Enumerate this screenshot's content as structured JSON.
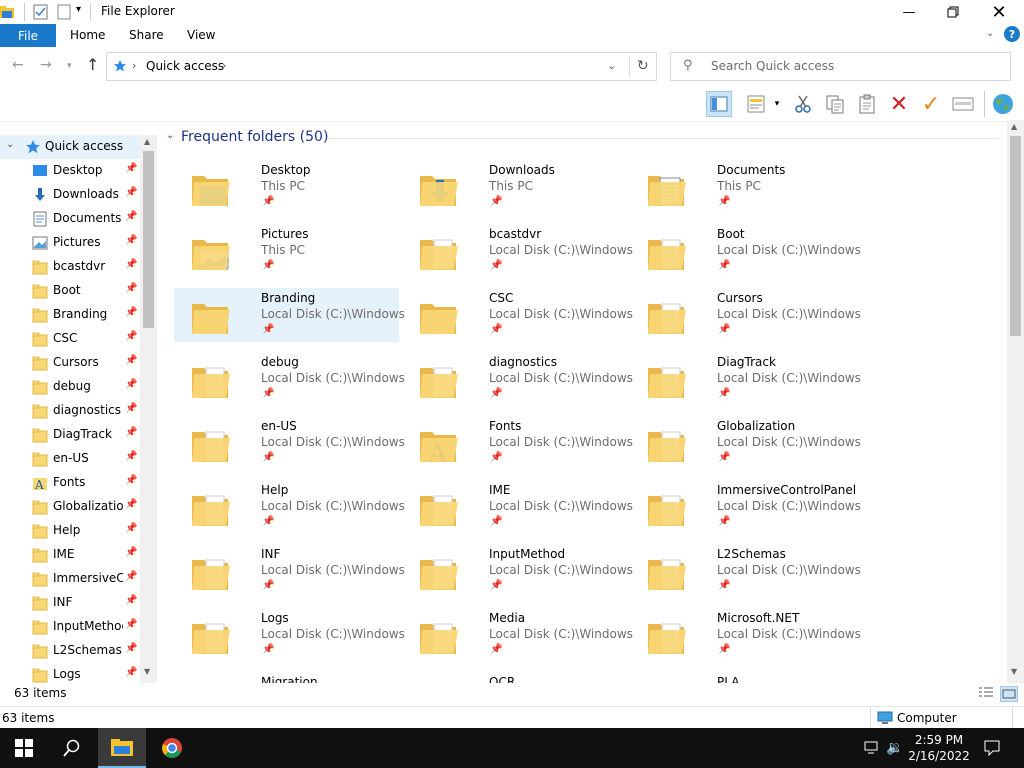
{
  "window": {
    "title": "File Explorer"
  },
  "ribbon": {
    "tabs": [
      {
        "label": "File"
      },
      {
        "label": "Home"
      },
      {
        "label": "Share"
      },
      {
        "label": "View"
      }
    ]
  },
  "address": {
    "path": "Quick access",
    "search_placeholder": "Search Quick access"
  },
  "nav": {
    "root_label": "Quick access",
    "items": [
      {
        "label": "Desktop",
        "icon": "desktop-icon"
      },
      {
        "label": "Downloads",
        "icon": "download-icon"
      },
      {
        "label": "Documents",
        "icon": "document-icon"
      },
      {
        "label": "Pictures",
        "icon": "picture-icon"
      },
      {
        "label": "bcastdvr",
        "icon": "folder-icon"
      },
      {
        "label": "Boot",
        "icon": "folder-icon"
      },
      {
        "label": "Branding",
        "icon": "folder-icon"
      },
      {
        "label": "CSC",
        "icon": "folder-icon"
      },
      {
        "label": "Cursors",
        "icon": "folder-icon"
      },
      {
        "label": "debug",
        "icon": "folder-icon"
      },
      {
        "label": "diagnostics",
        "icon": "folder-icon"
      },
      {
        "label": "DiagTrack",
        "icon": "folder-icon"
      },
      {
        "label": "en-US",
        "icon": "folder-icon"
      },
      {
        "label": "Fonts",
        "icon": "font-icon"
      },
      {
        "label": "Globalization",
        "icon": "folder-icon"
      },
      {
        "label": "Help",
        "icon": "folder-icon"
      },
      {
        "label": "IME",
        "icon": "folder-icon"
      },
      {
        "label": "ImmersiveCo",
        "icon": "folder-icon"
      },
      {
        "label": "INF",
        "icon": "folder-icon"
      },
      {
        "label": "InputMethod",
        "icon": "folder-icon"
      },
      {
        "label": "L2Schemas",
        "icon": "folder-icon"
      },
      {
        "label": "Logs",
        "icon": "folder-icon"
      }
    ]
  },
  "content": {
    "group_header": "Frequent folders (50)",
    "folders": [
      {
        "name": "Desktop",
        "location": "This PC",
        "overlay": "desktop"
      },
      {
        "name": "Downloads",
        "location": "This PC",
        "overlay": "download"
      },
      {
        "name": "Documents",
        "location": "This PC",
        "overlay": "document"
      },
      {
        "name": "Pictures",
        "location": "This PC",
        "overlay": "picture"
      },
      {
        "name": "bcastdvr",
        "location": "Local Disk (C:)\\Windows",
        "overlay": "paper"
      },
      {
        "name": "Boot",
        "location": "Local Disk (C:)\\Windows",
        "overlay": "paper"
      },
      {
        "name": "Branding",
        "location": "Local Disk (C:)\\Windows",
        "overlay": "none",
        "selected": true
      },
      {
        "name": "CSC",
        "location": "Local Disk (C:)\\Windows",
        "overlay": "none"
      },
      {
        "name": "Cursors",
        "location": "Local Disk (C:)\\Windows",
        "overlay": "paper"
      },
      {
        "name": "debug",
        "location": "Local Disk (C:)\\Windows",
        "overlay": "paper"
      },
      {
        "name": "diagnostics",
        "location": "Local Disk (C:)\\Windows",
        "overlay": "paper"
      },
      {
        "name": "DiagTrack",
        "location": "Local Disk (C:)\\Windows",
        "overlay": "paper"
      },
      {
        "name": "en-US",
        "location": "Local Disk (C:)\\Windows",
        "overlay": "paper"
      },
      {
        "name": "Fonts",
        "location": "Local Disk (C:)\\Windows",
        "overlay": "font"
      },
      {
        "name": "Globalization",
        "location": "Local Disk (C:)\\Windows",
        "overlay": "paper"
      },
      {
        "name": "Help",
        "location": "Local Disk (C:)\\Windows",
        "overlay": "paper"
      },
      {
        "name": "IME",
        "location": "Local Disk (C:)\\Windows",
        "overlay": "paper"
      },
      {
        "name": "ImmersiveControlPanel",
        "location": "Local Disk (C:)\\Windows",
        "overlay": "paper"
      },
      {
        "name": "INF",
        "location": "Local Disk (C:)\\Windows",
        "overlay": "paper"
      },
      {
        "name": "InputMethod",
        "location": "Local Disk (C:)\\Windows",
        "overlay": "paper"
      },
      {
        "name": "L2Schemas",
        "location": "Local Disk (C:)\\Windows",
        "overlay": "paper"
      },
      {
        "name": "Logs",
        "location": "Local Disk (C:)\\Windows",
        "overlay": "paper"
      },
      {
        "name": "Media",
        "location": "Local Disk (C:)\\Windows",
        "overlay": "paper"
      },
      {
        "name": "Microsoft.NET",
        "location": "Local Disk (C:)\\Windows",
        "overlay": "paper"
      },
      {
        "name": "Migration",
        "location": "",
        "overlay": "none"
      },
      {
        "name": "OCR",
        "location": "",
        "overlay": "none"
      },
      {
        "name": "PLA",
        "location": "",
        "overlay": "none"
      }
    ]
  },
  "status": {
    "items_count": "63 items",
    "items_count2": "63 items",
    "location_label": "Computer"
  },
  "taskbar": {
    "time": "2:59 PM",
    "date": "2/16/2022"
  },
  "colors": {
    "accent": "#1979ca",
    "folder": "#f8d775",
    "selection": "#e5f1fb"
  }
}
